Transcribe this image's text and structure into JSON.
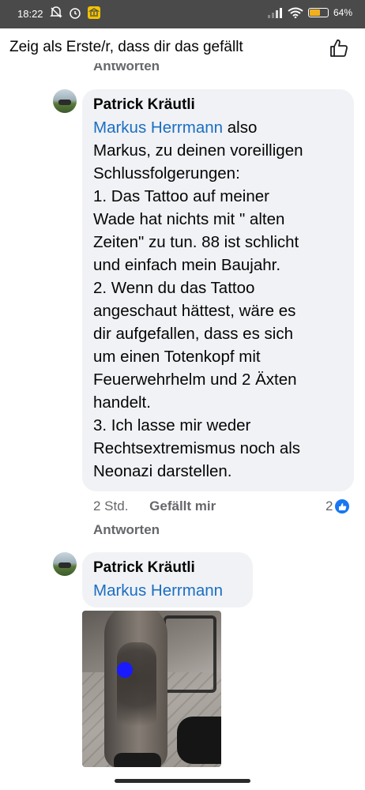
{
  "status_bar": {
    "time": "18:22",
    "battery_percent_text": "64",
    "battery_level": 0.64
  },
  "header": {
    "title": "Zeig als Erste/r, dass dir das gefällt"
  },
  "prev_reply_label": "Antworten",
  "comments": [
    {
      "author": "Patrick Kräutli",
      "mention": "Markus Herrmann",
      "lines": [
        " also",
        "Markus, zu deinen voreilligen",
        "Schlussfolgerungen:",
        "1. Das Tattoo auf meiner",
        "Wade hat nichts mit \" alten",
        "Zeiten\" zu tun. 88 ist schlicht",
        "und einfach mein Baujahr.",
        "2. Wenn du das Tattoo",
        "angeschaut hättest, wäre es",
        "dir aufgefallen, dass es sich",
        "um einen Totenkopf mit",
        "Feuerwehrhelm und 2 Äxten",
        "handelt.",
        "3. Ich lasse mir weder",
        "Rechtsextremismus noch als",
        "Neonazi darstellen."
      ],
      "time": "2 Std.",
      "like_label": "Gefällt mir",
      "reply_label": "Antworten",
      "reaction_count": "2"
    },
    {
      "author": "Patrick Kräutli",
      "mention": "Markus Herrmann"
    }
  ],
  "colors": {
    "mention": "#1b6ec2",
    "bubble": "#f0f2f5",
    "like_blue": "#1877f2"
  }
}
